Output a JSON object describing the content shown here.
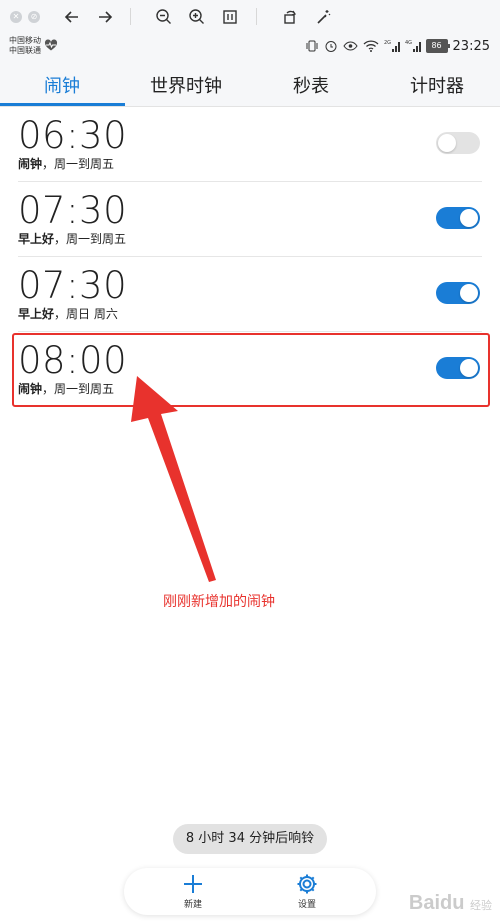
{
  "status_bar": {
    "carrier_1": "中国移动",
    "carrier_2": "中国联通",
    "battery": "86",
    "time": "23:25"
  },
  "tabs": [
    {
      "label": "闹钟",
      "active": true
    },
    {
      "label": "世界时钟",
      "active": false
    },
    {
      "label": "秒表",
      "active": false
    },
    {
      "label": "计时器",
      "active": false
    }
  ],
  "alarms": [
    {
      "time": "06:30",
      "name": "闹钟",
      "repeat": "，周一到周五",
      "enabled": false
    },
    {
      "time": "07:30",
      "name": "早上好",
      "repeat": "，周一到周五",
      "enabled": true
    },
    {
      "time": "07:30",
      "name": "早上好",
      "repeat": "，周日 周六",
      "enabled": true
    },
    {
      "time": "08:00",
      "name": "闹钟",
      "repeat": "，周一到周五",
      "enabled": true
    }
  ],
  "annotation": "刚刚新增加的闹钟",
  "countdown": "8 小时 34 分钟后响铃",
  "bottom_bar": {
    "new_label": "新建",
    "settings_label": "设置"
  },
  "watermark": {
    "logo": "Bai",
    "mark": "du",
    "sub": "经验"
  },
  "colors": {
    "accent": "#1a7dd6",
    "annotation_red": "#e8322d",
    "toggle_off": "#e3e3e3"
  }
}
